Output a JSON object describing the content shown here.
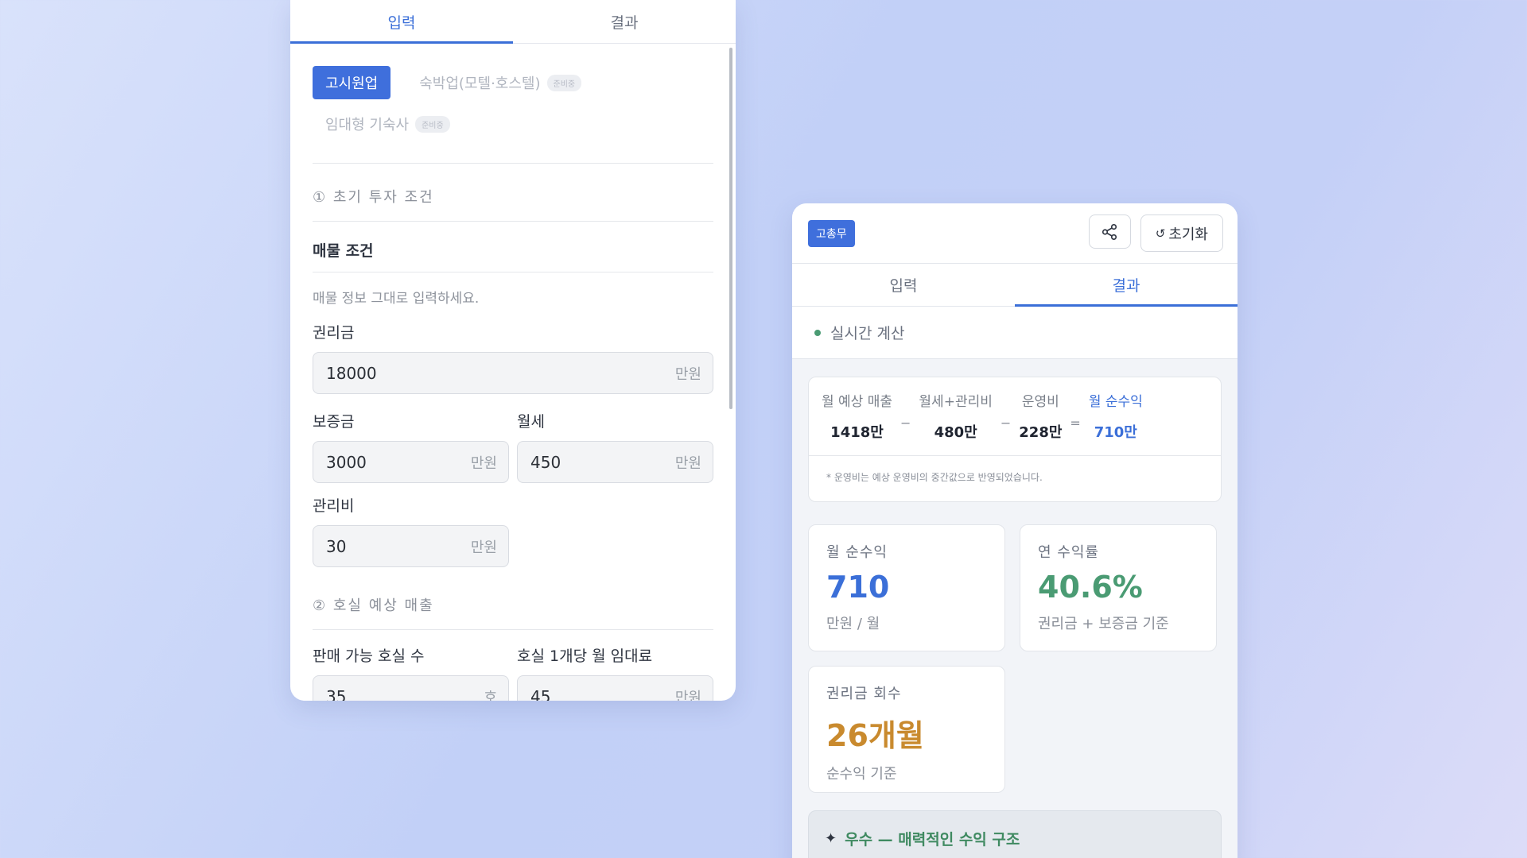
{
  "left": {
    "tabs": [
      "입력",
      "결과"
    ],
    "business_types": [
      {
        "label": "고시원업",
        "badge": ""
      },
      {
        "label": "숙박업(모텔·호스텔)",
        "badge": "준비중"
      },
      {
        "label": "임대형 기숙사",
        "badge": "준비중"
      }
    ],
    "section1": "① 초기 투자 조건",
    "property_head": "매물 조건",
    "property_hint": "매물 정보 그대로 입력하세요.",
    "key_money": {
      "label": "권리금",
      "value": "18000",
      "unit": "만원"
    },
    "deposit": {
      "label": "보증금",
      "value": "3000",
      "unit": "만원"
    },
    "rent": {
      "label": "월세",
      "value": "450",
      "unit": "만원"
    },
    "maintenance": {
      "label": "관리비",
      "value": "30",
      "unit": "만원"
    },
    "section2": "② 호실 예상 매출",
    "rooms": {
      "label": "판매 가능 호실 수",
      "value": "35",
      "unit": "호"
    },
    "room_rent": {
      "label": "호실 1개당 월 임대료",
      "value": "45",
      "unit": "만원"
    }
  },
  "right": {
    "badge": "고총무",
    "share_icon": "share-icon",
    "reset_label": "초기화",
    "tabs": [
      "입력",
      "결과"
    ],
    "live_label": "실시간 계산",
    "formula": {
      "revenue_label": "월 예상 매출",
      "revenue_value": "1418만",
      "rent_label": "월세+관리비",
      "rent_value": "480만",
      "opex_label": "운영비",
      "opex_value": "228만",
      "net_label": "월 순수익",
      "net_value": "710만",
      "minus": "−",
      "equals": "="
    },
    "note": "* 운영비는 예상 운영비의 중간값으로 반영되었습니다.",
    "metrics": [
      {
        "label": "월 순수익",
        "value": "710",
        "sub": "만원 / 월",
        "color": "#3b6fd8"
      },
      {
        "label": "연 수익률",
        "value": "40.6%",
        "sub": "권리금 + 보증금 기준",
        "color": "#4a9b73"
      },
      {
        "label": "권리금 회수",
        "value": "26개월",
        "sub": "순수익 기준",
        "color": "#c98a2e"
      }
    ],
    "banner": "우수 — 매력적인 수익 구조"
  }
}
